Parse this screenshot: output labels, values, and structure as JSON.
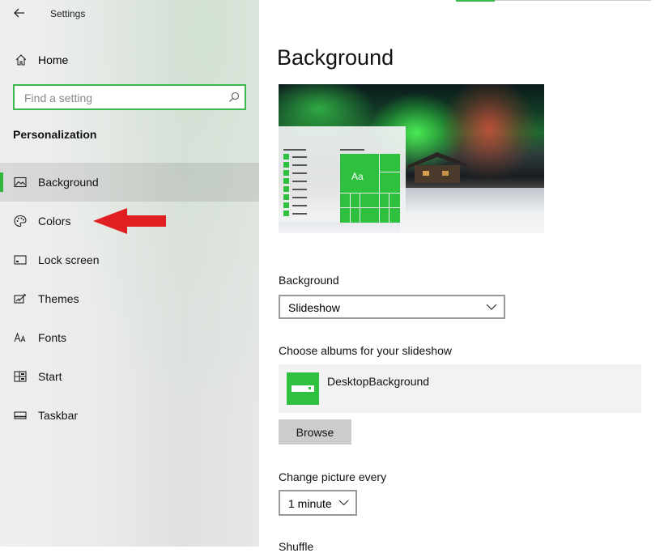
{
  "window": {
    "title": "Settings"
  },
  "sidebar": {
    "home_label": "Home",
    "search": {
      "placeholder": "Find a setting",
      "value": ""
    },
    "section_title": "Personalization",
    "items": [
      {
        "label": "Background",
        "icon": "picture-icon",
        "selected": true
      },
      {
        "label": "Colors",
        "icon": "palette-icon",
        "selected": false
      },
      {
        "label": "Lock screen",
        "icon": "lock-screen-icon",
        "selected": false
      },
      {
        "label": "Themes",
        "icon": "themes-icon",
        "selected": false
      },
      {
        "label": "Fonts",
        "icon": "fonts-icon",
        "selected": false
      },
      {
        "label": "Start",
        "icon": "start-icon",
        "selected": false
      },
      {
        "label": "Taskbar",
        "icon": "taskbar-icon",
        "selected": false
      }
    ]
  },
  "main": {
    "page_title": "Background",
    "preview": {
      "tile_label": "Aa"
    },
    "background_label": "Background",
    "background_value": "Slideshow",
    "albums_label": "Choose albums for your slideshow",
    "album_name": "DesktopBackground",
    "browse_label": "Browse",
    "change_label": "Change picture every",
    "change_value": "1 minute",
    "shuffle_label": "Shuffle"
  },
  "colors": {
    "accent": "#2fb83c",
    "annotation_arrow": "#e02020"
  }
}
